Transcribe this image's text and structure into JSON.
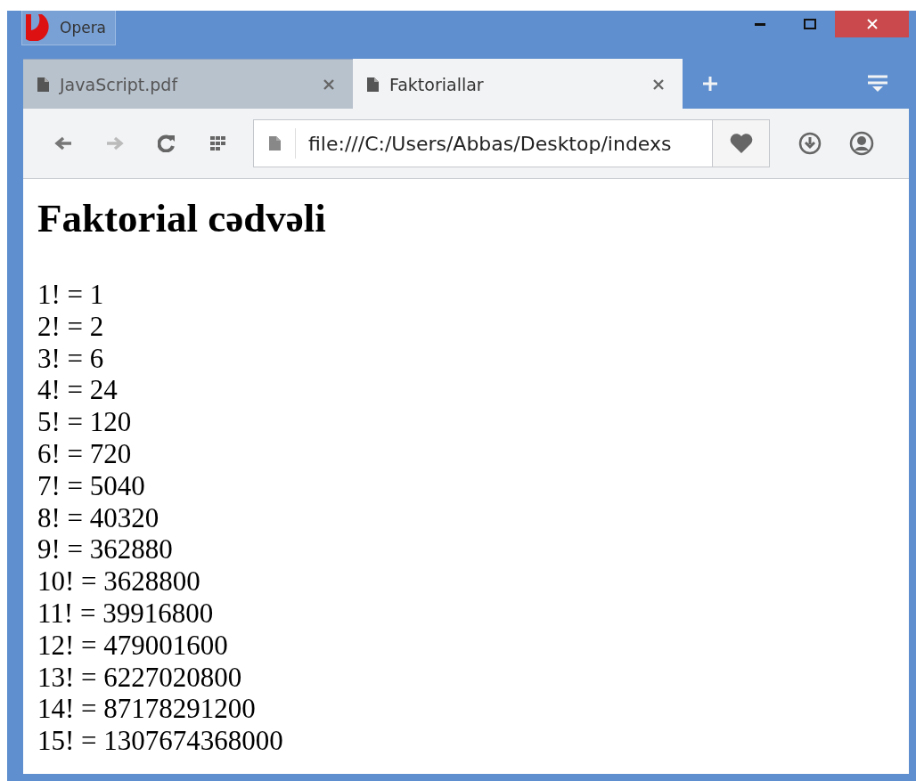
{
  "window": {
    "title": "Opera"
  },
  "tabs": [
    {
      "label": "JavaScript.pdf",
      "selected": false
    },
    {
      "label": "Faktoriallar",
      "selected": true
    }
  ],
  "address_bar": {
    "value": "file:///C:/Users/Abbas/Desktop/indexs"
  },
  "page": {
    "heading": "Faktorial cədvəli",
    "lines": [
      "1! = 1",
      "2! = 2",
      "3! = 6",
      "4! = 24",
      "5! = 120",
      "6! = 720",
      "7! = 5040",
      "8! = 40320",
      "9! = 362880",
      "10! = 3628800",
      "11! = 39916800",
      "12! = 479001600",
      "13! = 6227020800",
      "14! = 87178291200",
      "15! = 1307674368000"
    ]
  }
}
